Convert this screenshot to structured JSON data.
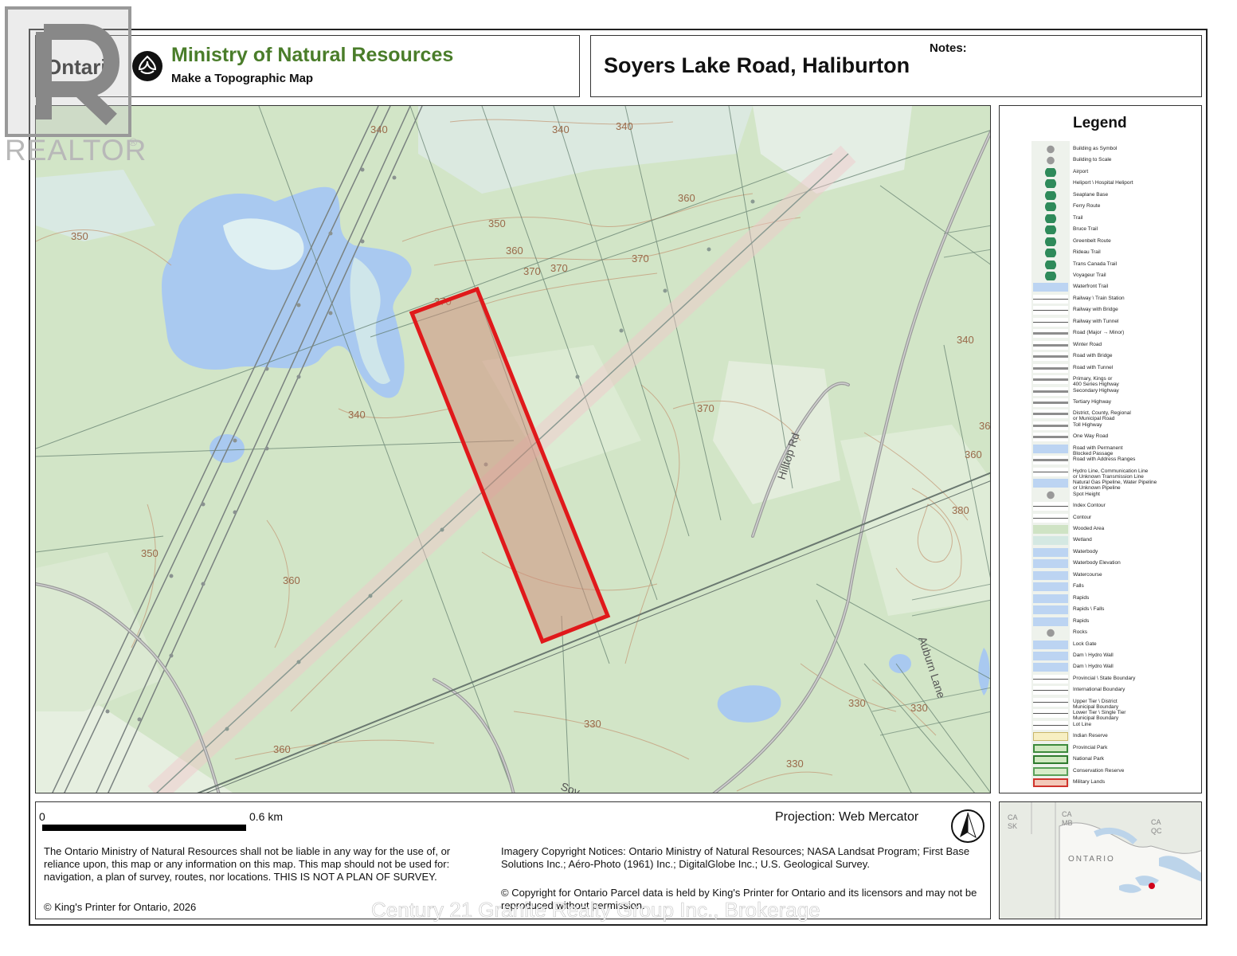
{
  "header": {
    "logo_word": "Ontario",
    "ministry": "Ministry of Natural Resources",
    "subtitle": "Make a Topographic Map",
    "map_title": "Soyers Lake Road, Haliburton",
    "notes_label": "Notes:"
  },
  "realtor": {
    "text": "REALTOR"
  },
  "map": {
    "contour_labels": [
      "340",
      "340",
      "340",
      "360",
      "350",
      "360",
      "370",
      "370",
      "370",
      "350",
      "340",
      "360",
      "370",
      "340",
      "360",
      "350",
      "370",
      "360",
      "380",
      "330",
      "330",
      "330",
      "330",
      "360"
    ],
    "road_labels": [
      "Hilltop Rd",
      "Auburn Lane",
      "Soy"
    ],
    "parcel_color": "#e0191b",
    "water_color": "#a9c9f0",
    "land_color": "#cfe3c4"
  },
  "legend": {
    "title": "Legend",
    "items": [
      "Building as Symbol",
      "Building to Scale",
      "Airport",
      "Heliport \\ Hospital Heliport",
      "Seaplane Base",
      "Ferry Route",
      "Trail",
      "Bruce Trail",
      "Greenbelt Route",
      "Rideau Trail",
      "Trans Canada Trail",
      "Voyageur Trail",
      "Waterfront Trail",
      "Railway \\ Train Station",
      "Railway with Bridge",
      "Railway with Tunnel",
      "Road (Major → Minor)",
      "Winter Road",
      "Road with Bridge",
      "Road with Tunnel",
      "Primary, Kings or\n400 Series Highway",
      "Secondary Highway",
      "Tertiary Highway",
      "District, County, Regional\nor Municipal Road",
      "Toll Highway",
      "One Way Road",
      "Road with Permanent\nBlocked Passage",
      "Road with Address Ranges",
      "Hydro Line, Communication Line\nor Unknown Transmission Line",
      "Natural Gas Pipeline, Water Pipeline\nor Unknown Pipeline",
      "Spot Height",
      "Index Contour",
      "Contour",
      "Wooded Area",
      "Wetland",
      "Waterbody",
      "Waterbody Elevation",
      "Watercourse",
      "Falls",
      "Rapids",
      "Rapids \\ Falls",
      "Rapids",
      "Rocks",
      "Lock Gate",
      "Dam \\ Hydro Wall",
      "Dam \\ Hydro Wall",
      "Provincial \\ State Boundary",
      "International Boundary",
      "Upper Tier \\ District\nMunicipal Boundary",
      "Lower Tier \\ Single Tier\nMunicipal Boundary",
      "Lot Line",
      "Indian Reserve",
      "Provincial Park",
      "National Park",
      "Conservation Reserve",
      "Military Lands"
    ]
  },
  "footer": {
    "scale_start": "0",
    "scale_end": "0.6 km",
    "projection": "Projection: Web Mercator",
    "disclaimer": "The Ontario Ministry of Natural Resources shall not be liable in any way for the use of, or reliance upon, this map or any information on this map.  This map should not be used for: navigation, a plan of survey, routes, nor locations. THIS IS NOT A PLAN OF SURVEY.",
    "imagery": "Imagery Copyright Notices: Ontario Ministry of Natural Resources; NASA Landsat Program; First Base Solutions Inc.; Aéro-Photo (1961) Inc.; DigitalGlobe Inc.; U.S. Geological Survey.",
    "parcel_copyright": "© Copyright for Ontario Parcel data is held by King's Printer for Ontario and its licensors and may not be reproduced without permission.",
    "kings_printer": "© King's Printer for Ontario, 2026"
  },
  "inset": {
    "labels": [
      "CA",
      "SK",
      "CA",
      "MB",
      "CA",
      "QC",
      "ONTARIO"
    ]
  },
  "watermark": "Century 21 Granite Realty Group Inc., Brokerage"
}
